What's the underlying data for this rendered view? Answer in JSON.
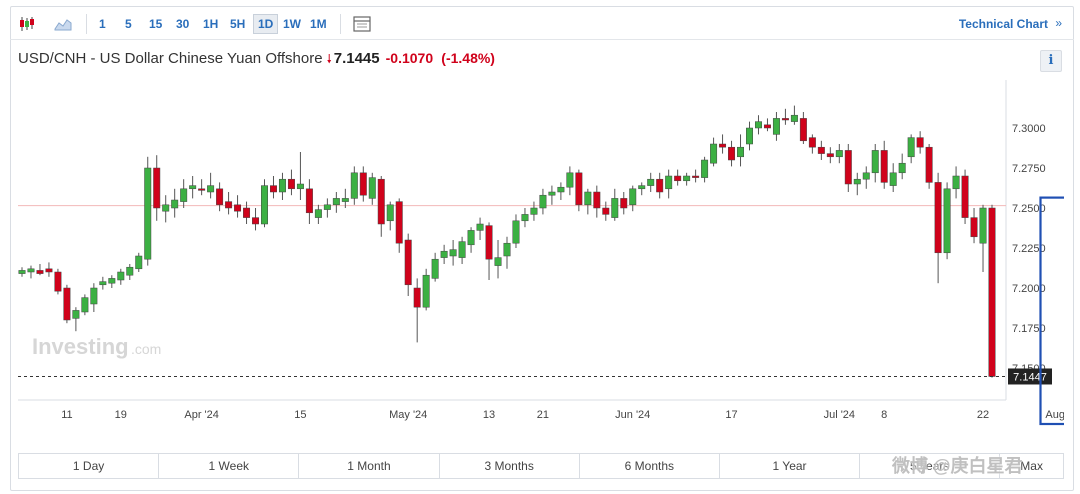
{
  "toolbar": {
    "candle_icon": "candlestick-icon",
    "area_icon": "area-chart-icon",
    "intervals": [
      "1",
      "5",
      "15",
      "30",
      "1H",
      "5H",
      "1D",
      "1W",
      "1M"
    ],
    "active_interval": "1D",
    "layout_icon": "chart-layout-icon",
    "technical_chart": "Technical Chart",
    "technical_arrow": "»"
  },
  "header": {
    "instrument": "USD/CNH - US Dollar Chinese Yuan Offshore",
    "price": "7.1445",
    "change": "-0.1070",
    "change_pct": "(-1.48%)",
    "info": "i"
  },
  "brand": {
    "watermark": "Investing",
    "watermark_suffix": ".com"
  },
  "social_watermark": "微博 @庚白星君",
  "ranges": [
    "1 Day",
    "1 Week",
    "1 Month",
    "3 Months",
    "6 Months",
    "1 Year",
    "5 years",
    "Max"
  ],
  "colors": {
    "up": "#3cb043",
    "down": "#d0021b",
    "highlight": "#1f4fb3"
  },
  "chart_data": {
    "type": "candlestick",
    "title": "",
    "xlabel": "",
    "ylabel": "",
    "ylim": [
      7.13,
      7.33
    ],
    "yticks": [
      "7.3000",
      "7.2750",
      "7.2500",
      "7.2250",
      "7.2000",
      "7.1750",
      "7.1500"
    ],
    "ytick_values": [
      7.3,
      7.275,
      7.25,
      7.225,
      7.2,
      7.175,
      7.15
    ],
    "xticks": [
      {
        "label": "11",
        "index": 5
      },
      {
        "label": "19",
        "index": 11
      },
      {
        "label": "Apr '24",
        "index": 20
      },
      {
        "label": "15",
        "index": 31
      },
      {
        "label": "May '24",
        "index": 43
      },
      {
        "label": "13",
        "index": 52
      },
      {
        "label": "21",
        "index": 58
      },
      {
        "label": "Jun '24",
        "index": 68
      },
      {
        "label": "17",
        "index": 79
      },
      {
        "label": "Jul '24",
        "index": 91
      },
      {
        "label": "8",
        "index": 96
      },
      {
        "label": "22",
        "index": 107
      },
      {
        "label": "Aug '24",
        "index": 116
      }
    ],
    "last_price_label": "7.1447",
    "last_price": 7.1447,
    "reference_line": 7.2515,
    "highlight_range": [
      114,
      117
    ],
    "candles": [
      {
        "o": 7.209,
        "h": 7.213,
        "l": 7.207,
        "c": 7.211
      },
      {
        "o": 7.21,
        "h": 7.214,
        "l": 7.206,
        "c": 7.212
      },
      {
        "o": 7.211,
        "h": 7.215,
        "l": 7.208,
        "c": 7.209
      },
      {
        "o": 7.212,
        "h": 7.216,
        "l": 7.207,
        "c": 7.21
      },
      {
        "o": 7.21,
        "h": 7.212,
        "l": 7.196,
        "c": 7.198
      },
      {
        "o": 7.2,
        "h": 7.202,
        "l": 7.178,
        "c": 7.18
      },
      {
        "o": 7.181,
        "h": 7.188,
        "l": 7.173,
        "c": 7.186
      },
      {
        "o": 7.185,
        "h": 7.196,
        "l": 7.183,
        "c": 7.194
      },
      {
        "o": 7.19,
        "h": 7.203,
        "l": 7.185,
        "c": 7.2
      },
      {
        "o": 7.202,
        "h": 7.207,
        "l": 7.199,
        "c": 7.204
      },
      {
        "o": 7.203,
        "h": 7.208,
        "l": 7.2,
        "c": 7.206
      },
      {
        "o": 7.205,
        "h": 7.212,
        "l": 7.202,
        "c": 7.21
      },
      {
        "o": 7.208,
        "h": 7.215,
        "l": 7.205,
        "c": 7.213
      },
      {
        "o": 7.212,
        "h": 7.222,
        "l": 7.21,
        "c": 7.22
      },
      {
        "o": 7.218,
        "h": 7.282,
        "l": 7.214,
        "c": 7.275
      },
      {
        "o": 7.275,
        "h": 7.283,
        "l": 7.242,
        "c": 7.25
      },
      {
        "o": 7.248,
        "h": 7.258,
        "l": 7.241,
        "c": 7.252
      },
      {
        "o": 7.25,
        "h": 7.262,
        "l": 7.244,
        "c": 7.255
      },
      {
        "o": 7.254,
        "h": 7.268,
        "l": 7.25,
        "c": 7.262
      },
      {
        "o": 7.262,
        "h": 7.27,
        "l": 7.256,
        "c": 7.264
      },
      {
        "o": 7.262,
        "h": 7.268,
        "l": 7.258,
        "c": 7.261
      },
      {
        "o": 7.26,
        "h": 7.272,
        "l": 7.256,
        "c": 7.264
      },
      {
        "o": 7.262,
        "h": 7.266,
        "l": 7.248,
        "c": 7.252
      },
      {
        "o": 7.254,
        "h": 7.26,
        "l": 7.246,
        "c": 7.25
      },
      {
        "o": 7.252,
        "h": 7.258,
        "l": 7.244,
        "c": 7.248
      },
      {
        "o": 7.25,
        "h": 7.254,
        "l": 7.24,
        "c": 7.244
      },
      {
        "o": 7.244,
        "h": 7.25,
        "l": 7.236,
        "c": 7.24
      },
      {
        "o": 7.24,
        "h": 7.268,
        "l": 7.238,
        "c": 7.264
      },
      {
        "o": 7.264,
        "h": 7.27,
        "l": 7.256,
        "c": 7.26
      },
      {
        "o": 7.26,
        "h": 7.272,
        "l": 7.255,
        "c": 7.268
      },
      {
        "o": 7.268,
        "h": 7.274,
        "l": 7.258,
        "c": 7.262
      },
      {
        "o": 7.262,
        "h": 7.285,
        "l": 7.255,
        "c": 7.265
      },
      {
        "o": 7.262,
        "h": 7.268,
        "l": 7.24,
        "c": 7.247
      },
      {
        "o": 7.244,
        "h": 7.252,
        "l": 7.24,
        "c": 7.249
      },
      {
        "o": 7.249,
        "h": 7.256,
        "l": 7.244,
        "c": 7.252
      },
      {
        "o": 7.252,
        "h": 7.26,
        "l": 7.247,
        "c": 7.256
      },
      {
        "o": 7.254,
        "h": 7.262,
        "l": 7.25,
        "c": 7.256
      },
      {
        "o": 7.256,
        "h": 7.276,
        "l": 7.252,
        "c": 7.272
      },
      {
        "o": 7.272,
        "h": 7.276,
        "l": 7.254,
        "c": 7.258
      },
      {
        "o": 7.256,
        "h": 7.272,
        "l": 7.252,
        "c": 7.269
      },
      {
        "o": 7.268,
        "h": 7.27,
        "l": 7.232,
        "c": 7.24
      },
      {
        "o": 7.242,
        "h": 7.254,
        "l": 7.236,
        "c": 7.252
      },
      {
        "o": 7.254,
        "h": 7.256,
        "l": 7.222,
        "c": 7.228
      },
      {
        "o": 7.23,
        "h": 7.234,
        "l": 7.195,
        "c": 7.202
      },
      {
        "o": 7.2,
        "h": 7.206,
        "l": 7.166,
        "c": 7.188
      },
      {
        "o": 7.188,
        "h": 7.212,
        "l": 7.186,
        "c": 7.208
      },
      {
        "o": 7.206,
        "h": 7.222,
        "l": 7.204,
        "c": 7.218
      },
      {
        "o": 7.219,
        "h": 7.227,
        "l": 7.215,
        "c": 7.223
      },
      {
        "o": 7.22,
        "h": 7.23,
        "l": 7.214,
        "c": 7.224
      },
      {
        "o": 7.219,
        "h": 7.232,
        "l": 7.215,
        "c": 7.229
      },
      {
        "o": 7.227,
        "h": 7.238,
        "l": 7.222,
        "c": 7.236
      },
      {
        "o": 7.236,
        "h": 7.244,
        "l": 7.23,
        "c": 7.24
      },
      {
        "o": 7.239,
        "h": 7.241,
        "l": 7.205,
        "c": 7.218
      },
      {
        "o": 7.214,
        "h": 7.23,
        "l": 7.206,
        "c": 7.219
      },
      {
        "o": 7.22,
        "h": 7.232,
        "l": 7.212,
        "c": 7.228
      },
      {
        "o": 7.228,
        "h": 7.246,
        "l": 7.225,
        "c": 7.242
      },
      {
        "o": 7.242,
        "h": 7.25,
        "l": 7.238,
        "c": 7.246
      },
      {
        "o": 7.246,
        "h": 7.254,
        "l": 7.242,
        "c": 7.25
      },
      {
        "o": 7.25,
        "h": 7.262,
        "l": 7.246,
        "c": 7.258
      },
      {
        "o": 7.258,
        "h": 7.264,
        "l": 7.252,
        "c": 7.26
      },
      {
        "o": 7.26,
        "h": 7.266,
        "l": 7.255,
        "c": 7.263
      },
      {
        "o": 7.263,
        "h": 7.276,
        "l": 7.258,
        "c": 7.272
      },
      {
        "o": 7.272,
        "h": 7.274,
        "l": 7.248,
        "c": 7.252
      },
      {
        "o": 7.252,
        "h": 7.262,
        "l": 7.246,
        "c": 7.26
      },
      {
        "o": 7.26,
        "h": 7.264,
        "l": 7.244,
        "c": 7.25
      },
      {
        "o": 7.25,
        "h": 7.254,
        "l": 7.242,
        "c": 7.246
      },
      {
        "o": 7.244,
        "h": 7.262,
        "l": 7.242,
        "c": 7.256
      },
      {
        "o": 7.256,
        "h": 7.26,
        "l": 7.246,
        "c": 7.25
      },
      {
        "o": 7.252,
        "h": 7.264,
        "l": 7.248,
        "c": 7.262
      },
      {
        "o": 7.262,
        "h": 7.266,
        "l": 7.258,
        "c": 7.264
      },
      {
        "o": 7.264,
        "h": 7.272,
        "l": 7.26,
        "c": 7.268
      },
      {
        "o": 7.268,
        "h": 7.272,
        "l": 7.256,
        "c": 7.26
      },
      {
        "o": 7.262,
        "h": 7.274,
        "l": 7.256,
        "c": 7.27
      },
      {
        "o": 7.27,
        "h": 7.274,
        "l": 7.264,
        "c": 7.267
      },
      {
        "o": 7.267,
        "h": 7.272,
        "l": 7.264,
        "c": 7.27
      },
      {
        "o": 7.27,
        "h": 7.274,
        "l": 7.266,
        "c": 7.269
      },
      {
        "o": 7.269,
        "h": 7.282,
        "l": 7.266,
        "c": 7.28
      },
      {
        "o": 7.278,
        "h": 7.294,
        "l": 7.276,
        "c": 7.29
      },
      {
        "o": 7.29,
        "h": 7.296,
        "l": 7.284,
        "c": 7.288
      },
      {
        "o": 7.288,
        "h": 7.292,
        "l": 7.276,
        "c": 7.28
      },
      {
        "o": 7.282,
        "h": 7.296,
        "l": 7.276,
        "c": 7.288
      },
      {
        "o": 7.29,
        "h": 7.304,
        "l": 7.286,
        "c": 7.3
      },
      {
        "o": 7.3,
        "h": 7.308,
        "l": 7.296,
        "c": 7.304
      },
      {
        "o": 7.302,
        "h": 7.306,
        "l": 7.298,
        "c": 7.3
      },
      {
        "o": 7.296,
        "h": 7.31,
        "l": 7.292,
        "c": 7.306
      },
      {
        "o": 7.306,
        "h": 7.312,
        "l": 7.302,
        "c": 7.305
      },
      {
        "o": 7.304,
        "h": 7.314,
        "l": 7.302,
        "c": 7.308
      },
      {
        "o": 7.306,
        "h": 7.31,
        "l": 7.29,
        "c": 7.292
      },
      {
        "o": 7.294,
        "h": 7.296,
        "l": 7.284,
        "c": 7.288
      },
      {
        "o": 7.288,
        "h": 7.292,
        "l": 7.28,
        "c": 7.284
      },
      {
        "o": 7.284,
        "h": 7.288,
        "l": 7.278,
        "c": 7.282
      },
      {
        "o": 7.282,
        "h": 7.29,
        "l": 7.278,
        "c": 7.286
      },
      {
        "o": 7.286,
        "h": 7.29,
        "l": 7.26,
        "c": 7.265
      },
      {
        "o": 7.265,
        "h": 7.272,
        "l": 7.258,
        "c": 7.268
      },
      {
        "o": 7.268,
        "h": 7.276,
        "l": 7.262,
        "c": 7.272
      },
      {
        "o": 7.272,
        "h": 7.29,
        "l": 7.266,
        "c": 7.286
      },
      {
        "o": 7.286,
        "h": 7.292,
        "l": 7.262,
        "c": 7.266
      },
      {
        "o": 7.264,
        "h": 7.278,
        "l": 7.26,
        "c": 7.272
      },
      {
        "o": 7.272,
        "h": 7.284,
        "l": 7.268,
        "c": 7.278
      },
      {
        "o": 7.282,
        "h": 7.296,
        "l": 7.278,
        "c": 7.294
      },
      {
        "o": 7.294,
        "h": 7.298,
        "l": 7.284,
        "c": 7.288
      },
      {
        "o": 7.288,
        "h": 7.29,
        "l": 7.262,
        "c": 7.266
      },
      {
        "o": 7.266,
        "h": 7.272,
        "l": 7.203,
        "c": 7.222
      },
      {
        "o": 7.222,
        "h": 7.266,
        "l": 7.218,
        "c": 7.262
      },
      {
        "o": 7.262,
        "h": 7.276,
        "l": 7.256,
        "c": 7.27
      },
      {
        "o": 7.27,
        "h": 7.274,
        "l": 7.24,
        "c": 7.244
      },
      {
        "o": 7.244,
        "h": 7.25,
        "l": 7.228,
        "c": 7.232
      },
      {
        "o": 7.228,
        "h": 7.252,
        "l": 7.21,
        "c": 7.25
      },
      {
        "o": 7.25,
        "h": 7.252,
        "l": 7.144,
        "c": 7.1447
      }
    ]
  }
}
